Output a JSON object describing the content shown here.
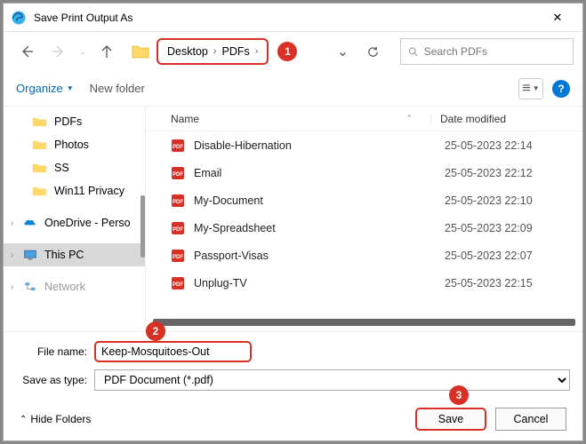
{
  "title": "Save Print Output As",
  "breadcrumb": {
    "item1": "Desktop",
    "item2": "PDFs"
  },
  "callouts": {
    "c1": "1",
    "c2": "2",
    "c3": "3"
  },
  "search": {
    "placeholder": "Search PDFs"
  },
  "toolbar": {
    "organize": "Organize",
    "newfolder": "New folder",
    "help": "?"
  },
  "sidebar": {
    "pdfs": "PDFs",
    "photos": "Photos",
    "ss": "SS",
    "win11": "Win11 Privacy",
    "onedrive": "OneDrive - Perso",
    "thispc": "This PC",
    "network": "Network"
  },
  "columns": {
    "name": "Name",
    "date": "Date modified"
  },
  "files": {
    "f1": {
      "name": "Disable-Hibernation",
      "date": "25-05-2023 22:14"
    },
    "f2": {
      "name": "Email",
      "date": "25-05-2023 22:12"
    },
    "f3": {
      "name": "My-Document",
      "date": "25-05-2023 22:10"
    },
    "f4": {
      "name": "My-Spreadsheet",
      "date": "25-05-2023 22:09"
    },
    "f5": {
      "name": "Passport-Visas",
      "date": "25-05-2023 22:07"
    },
    "f6": {
      "name": "Unplug-TV",
      "date": "25-05-2023 22:15"
    }
  },
  "form": {
    "filename_label": "File name:",
    "filename_value": "Keep-Mosquitoes-Out",
    "savetype_label": "Save as type:",
    "savetype_value": "PDF Document (*.pdf)"
  },
  "footer": {
    "hide": "Hide Folders",
    "save": "Save",
    "cancel": "Cancel"
  }
}
